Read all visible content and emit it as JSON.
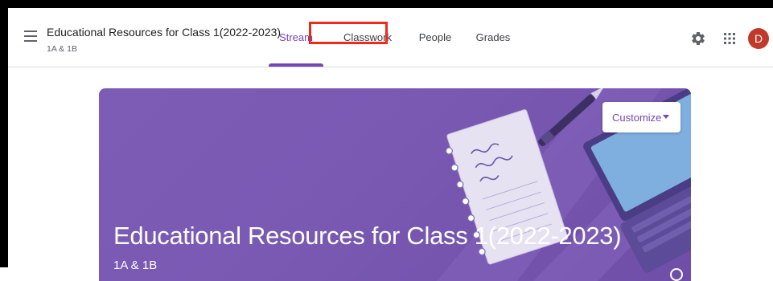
{
  "header": {
    "class_title": "Educational Resources for Class 1(2022-2023)",
    "class_subtitle": "1A & 1B",
    "avatar_letter": "D"
  },
  "tabs": [
    {
      "label": "Stream",
      "active": true
    },
    {
      "label": "Classwork",
      "active": false
    },
    {
      "label": "People",
      "active": false
    },
    {
      "label": "Grades",
      "active": false
    }
  ],
  "banner": {
    "title": "Educational Resources for Class 1(2022-2023)",
    "subtitle": "1A & 1B",
    "customize_label": "Customize"
  },
  "icons": {
    "menu": "hamburger-menu-icon",
    "settings": "gear-icon",
    "apps": "apps-grid-icon",
    "customize_caret": "caret-down-icon"
  },
  "colors": {
    "accent": "#7248b9",
    "banner": "#7a59b3",
    "highlight": "#f02a1a",
    "avatar": "#c0392b"
  }
}
